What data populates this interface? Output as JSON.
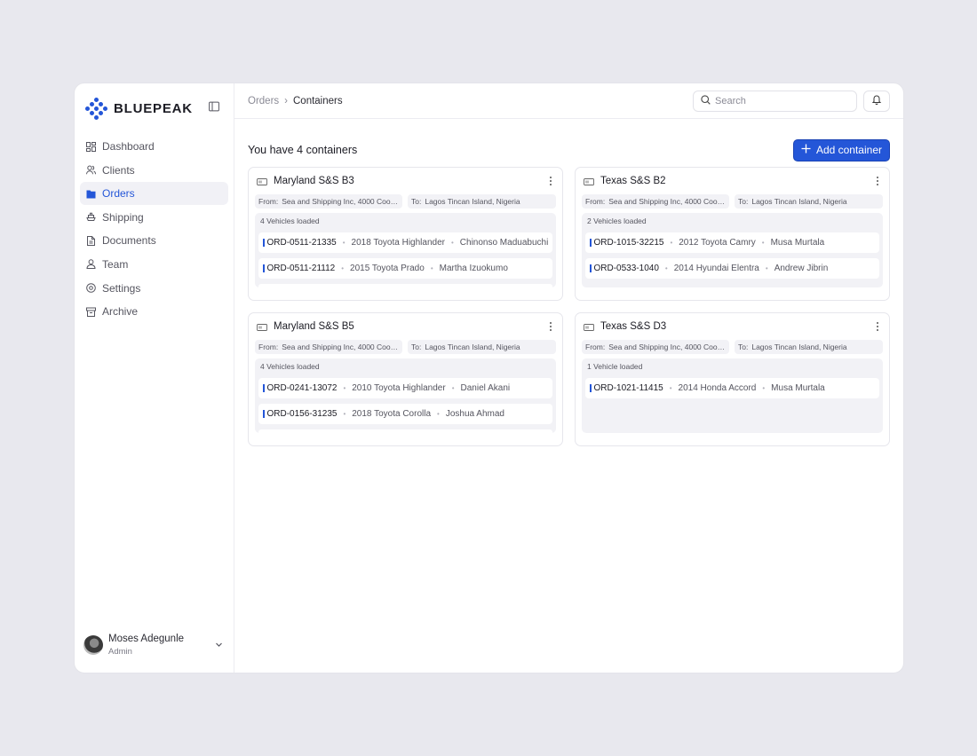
{
  "brand": {
    "name": "BLUEPEAK"
  },
  "nav": [
    {
      "label": "Dashboard",
      "icon": "dashboard-icon",
      "active": false
    },
    {
      "label": "Clients",
      "icon": "clients-icon",
      "active": false
    },
    {
      "label": "Orders",
      "icon": "orders-icon",
      "active": true
    },
    {
      "label": "Shipping",
      "icon": "shipping-icon",
      "active": false
    },
    {
      "label": "Documents",
      "icon": "documents-icon",
      "active": false
    },
    {
      "label": "Team",
      "icon": "team-icon",
      "active": false
    },
    {
      "label": "Settings",
      "icon": "settings-icon",
      "active": false
    },
    {
      "label": "Archive",
      "icon": "archive-icon",
      "active": false
    }
  ],
  "user": {
    "name": "Moses Adegunle",
    "role": "Admin"
  },
  "breadcrumb": {
    "parent": "Orders",
    "separator": "›",
    "current": "Containers"
  },
  "search": {
    "placeholder": "Search"
  },
  "header": {
    "title": "You have 4 containers",
    "add_button": "Add container"
  },
  "colors": {
    "accent": "#2456d8",
    "background": "#e8e8ee",
    "card_fill": "#f2f2f6"
  },
  "containers": [
    {
      "name": "Maryland S&S B3",
      "from_label": "From:",
      "from": "Sea and Shipping Inc, 4000 Coolidg...",
      "to_label": "To:",
      "to": "Lagos Tincan Island, Nigeria",
      "loaded": "4 Vehicles loaded",
      "vehicles": [
        {
          "id": "ORD-0511-21335",
          "car": "2018 Toyota Highlander",
          "client": "Chinonso Maduabuchi"
        },
        {
          "id": "ORD-0511-21112",
          "car": "2015 Toyota Prado",
          "client": "Martha Izuokumo"
        }
      ]
    },
    {
      "name": "Texas S&S B2",
      "from_label": "From:",
      "from": "Sea and Shipping Inc, 4000 Coolidg...",
      "to_label": "To:",
      "to": "Lagos Tincan Island, Nigeria",
      "loaded": "2 Vehicles loaded",
      "vehicles": [
        {
          "id": "ORD-1015-32215",
          "car": "2012 Toyota Camry",
          "client": "Musa Murtala"
        },
        {
          "id": "ORD-0533-1040",
          "car": "2014 Hyundai Elentra",
          "client": "Andrew Jibrin"
        }
      ]
    },
    {
      "name": "Maryland S&S B5",
      "from_label": "From:",
      "from": "Sea and Shipping Inc, 4000 Coolidg...",
      "to_label": "To:",
      "to": "Lagos Tincan Island, Nigeria",
      "loaded": "4 Vehicles loaded",
      "vehicles": [
        {
          "id": "ORD-0241-13072",
          "car": "2010 Toyota Highlander",
          "client": "Daniel Akani"
        },
        {
          "id": "ORD-0156-31235",
          "car": "2018 Toyota Corolla",
          "client": "Joshua Ahmad"
        }
      ]
    },
    {
      "name": "Texas S&S D3",
      "from_label": "From:",
      "from": "Sea and Shipping Inc, 4000 Coolidg...",
      "to_label": "To:",
      "to": "Lagos Tincan Island, Nigeria",
      "loaded": "1 Vehicle loaded",
      "vehicles": [
        {
          "id": "ORD-1021-11415",
          "car": "2014 Honda Accord",
          "client": "Musa Murtala"
        }
      ]
    }
  ]
}
